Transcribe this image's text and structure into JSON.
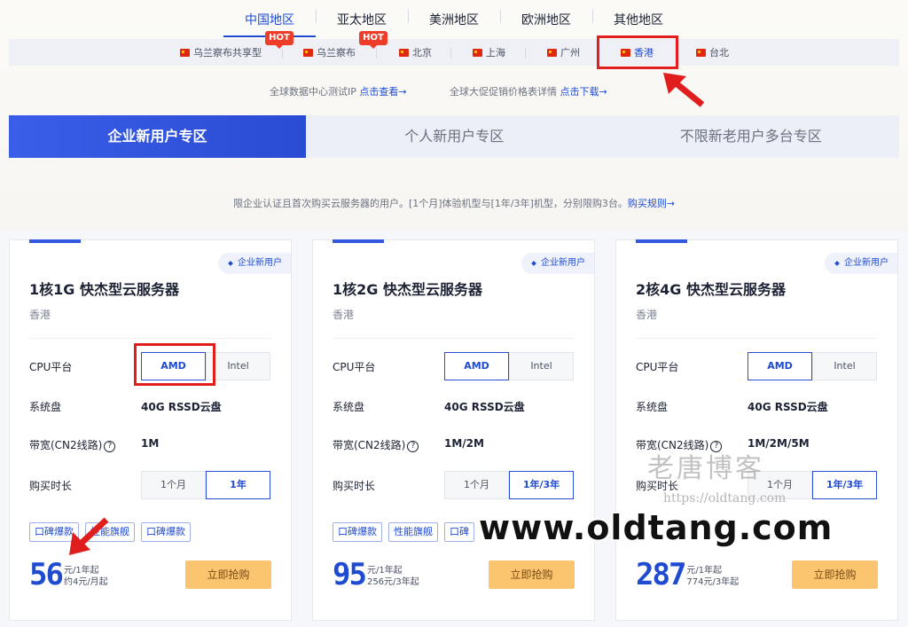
{
  "regions": [
    "中国地区",
    "亚太地区",
    "美洲地区",
    "欧洲地区",
    "其他地区"
  ],
  "cities": [
    "乌兰察布共享型",
    "乌兰察布",
    "北京",
    "上海",
    "广州",
    "香港",
    "台北"
  ],
  "hot_label": "HOT",
  "info": {
    "ip_text": "全球数据中心测试IP",
    "ip_link": "点击查看→",
    "price_text": "全球大促促销价格表详情",
    "price_link": "点击下载→"
  },
  "segments": [
    "企业新用户专区",
    "个人新用户专区",
    "不限新老用户多台专区"
  ],
  "notice": {
    "text": "限企业认证且首次购买云服务器的用户。[1个月]体验机型与[1年/3年]机型，分别限购3台。",
    "link": "购买规则→"
  },
  "labels": {
    "cpu": "CPU平台",
    "disk": "系统盘",
    "bandwidth": "带宽(CN2线路)",
    "duration": "购买时长",
    "help": "?"
  },
  "cards": [
    {
      "tag": "企业新用户",
      "title": "1核1G 快杰型云服务器",
      "region": "香港",
      "cpu_options": [
        "AMD",
        "Intel"
      ],
      "disk": "40G RSSD云盘",
      "bandwidth": "1M",
      "durations": [
        "1个月",
        "1年"
      ],
      "badges": [
        "口碑爆款",
        "性能旗舰",
        "口碑爆款"
      ],
      "price": "56",
      "price_unit": "元/1年起",
      "price_alt": "约4元/月起",
      "buy": "立即抢购"
    },
    {
      "tag": "企业新用户",
      "title": "1核2G 快杰型云服务器",
      "region": "香港",
      "cpu_options": [
        "AMD",
        "Intel"
      ],
      "disk": "40G RSSD云盘",
      "bandwidth": "1M/2M",
      "durations": [
        "1个月",
        "1年/3年"
      ],
      "badges": [
        "口碑爆款",
        "性能旗舰",
        "口碑"
      ],
      "price": "95",
      "price_unit": "元/1年起",
      "price_alt": "256元/3年起",
      "buy": "立即抢购"
    },
    {
      "tag": "企业新用户",
      "title": "2核4G 快杰型云服务器",
      "region": "香港",
      "cpu_options": [
        "AMD",
        "Intel"
      ],
      "disk": "40G RSSD云盘",
      "bandwidth": "1M/2M/5M",
      "durations": [
        "1个月",
        "1年/3年"
      ],
      "badges": [
        "",
        "",
        ""
      ],
      "price": "287",
      "price_unit": "元/1年起",
      "price_alt": "774元/3年起",
      "buy": "立即抢购"
    }
  ],
  "watermark": {
    "cn": "老唐博客",
    "url": "https://oldtang.com",
    "big": "www.oldtang.com"
  },
  "colors": {
    "primary": "#1f4bd1",
    "buy_button": "#fbc46f",
    "highlight": "#e01e1e"
  }
}
